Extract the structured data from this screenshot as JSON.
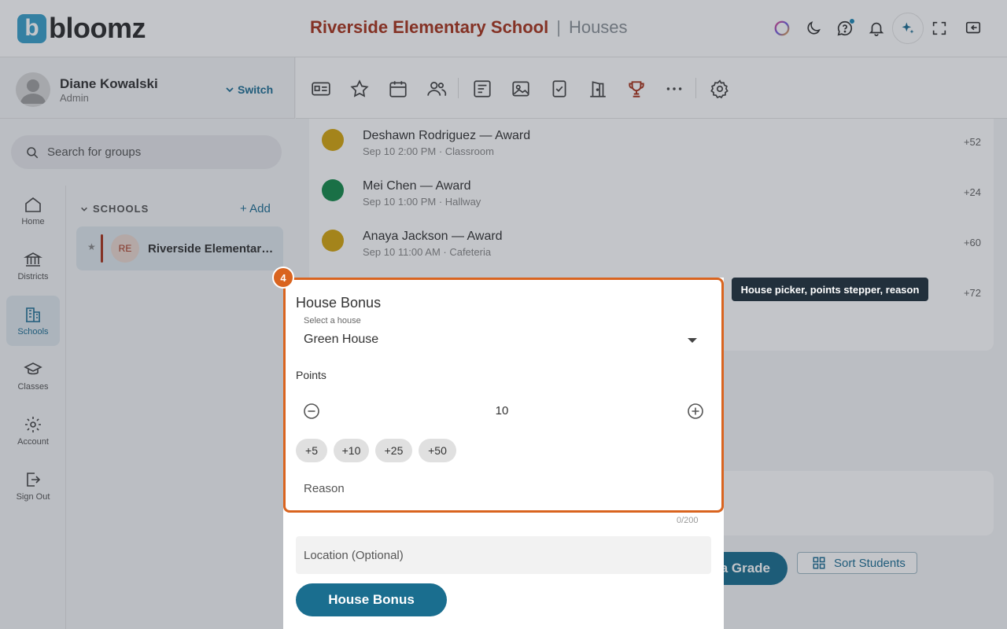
{
  "brand": {
    "name": "bloomz",
    "mark": "b",
    "color": "#3aa0c9"
  },
  "header": {
    "school": "Riverside Elementary School",
    "separator": "|",
    "section": "Houses"
  },
  "profile": {
    "name": "Diane Kowalski",
    "role": "Admin",
    "switch_label": "Switch"
  },
  "search": {
    "placeholder": "Search for groups"
  },
  "nav": [
    {
      "label": "Home",
      "icon": "home-icon"
    },
    {
      "label": "Districts",
      "icon": "districts-icon"
    },
    {
      "label": "Schools",
      "icon": "schools-icon",
      "active": true
    },
    {
      "label": "Classes",
      "icon": "classes-icon"
    },
    {
      "label": "Account",
      "icon": "gear-icon"
    },
    {
      "label": "Sign Out",
      "icon": "signout-icon"
    }
  ],
  "schools": {
    "heading": "SCHOOLS",
    "add_label": "Add",
    "items": [
      {
        "initials": "RE",
        "name": "Riverside Elementary School"
      }
    ]
  },
  "feed": [
    {
      "title": "Deshawn Rodriguez — Award",
      "meta": "Sep 10 2:00 PM · Classroom",
      "points": "+52",
      "color": "#d4a50f"
    },
    {
      "title": "Mei Chen — Award",
      "meta": "Sep 10 1:00 PM · Hallway",
      "points": "+24",
      "color": "#16894a"
    },
    {
      "title": "Anaya Jackson — Award",
      "meta": "Sep 10 11:00 AM · Cafeteria",
      "points": "+60",
      "color": "#d4a50f"
    },
    {
      "title": "",
      "meta": "",
      "points": "+72",
      "color": ""
    }
  ],
  "background_actions": {
    "grade_label": "a Grade",
    "sort_label": "Sort Students"
  },
  "dialog": {
    "title": "House Bonus",
    "select_label": "Select a house",
    "select_value": "Green House",
    "points_label": "Points",
    "points_value": "10",
    "chips": [
      "+5",
      "+10",
      "+25",
      "+50"
    ],
    "reason_placeholder": "Reason",
    "counter": "0/200",
    "location_placeholder": "Location (Optional)",
    "submit_label": "House Bonus"
  },
  "walkthrough": {
    "step": "4",
    "tooltip": "House picker, points stepper, reason",
    "accent": "#d9641f"
  }
}
